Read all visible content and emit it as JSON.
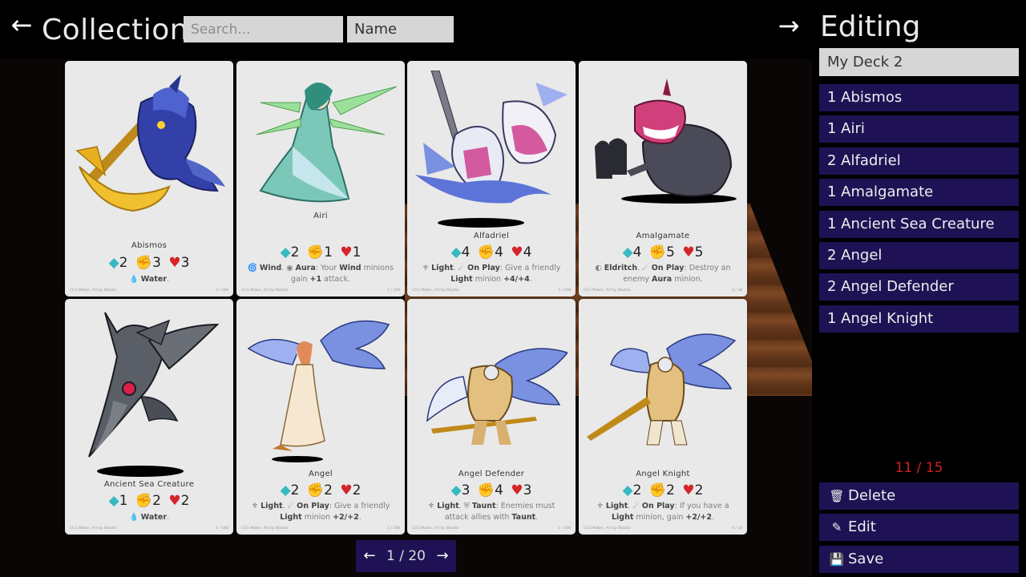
{
  "header": {
    "back_icon": "arrow-left-icon",
    "back_glyph": "←",
    "title": "Collection",
    "search_placeholder": "Search...",
    "sort_value": "Name",
    "forward_icon": "arrow-right-icon",
    "forward_glyph": "→"
  },
  "cards": [
    {
      "name": "Abismos",
      "mana": "2",
      "attack": "3",
      "health": "3",
      "text_html": "💧 <b>Water</b>.",
      "foot_left": "CCG Maker, Art by Blaatio",
      "foot_right": "1 / 168"
    },
    {
      "name": "Airi",
      "mana": "2",
      "attack": "1",
      "health": "1",
      "text_html": "🌀 <b>Wind</b>. ◉ <b>Aura</b>: Your <b>Wind</b> minions gain <b>+1</b> attack.",
      "foot_left": "CCG Maker, Art by Blaatio",
      "foot_right": "1 / 168"
    },
    {
      "name": "Alfadriel",
      "mana": "4",
      "attack": "4",
      "health": "4",
      "text_html": "⚜ <b>Light</b>. ☄ <b>On Play</b>: Give a friendly <b>Light</b> minion <b>+4/+4</b>.",
      "foot_left": "CCG Maker, Art by Blaatio",
      "foot_right": "1 / 168"
    },
    {
      "name": "Amalgamate",
      "mana": "4",
      "attack": "5",
      "health": "5",
      "text_html": "◐ <b>Eldritch</b>. ☄ <b>On Play</b>: Destroy an enemy <b>Aura</b> minion.",
      "foot_left": "CCG Maker, Art by Blaatio",
      "foot_right": "4 / 38"
    },
    {
      "name": "Ancient Sea Creature",
      "mana": "1",
      "attack": "2",
      "health": "2",
      "text_html": "💧 <b>Water</b>.",
      "foot_left": "CCG Maker, Art by Blaatio",
      "foot_right": "1 / 168"
    },
    {
      "name": "Angel",
      "mana": "2",
      "attack": "2",
      "health": "2",
      "text_html": "⚜ <b>Light</b>. ☄ <b>On Play</b>: Give a friendly <b>Light</b> minion <b>+2/+2</b>.",
      "foot_left": "CCG Maker, Art by Blaatio",
      "foot_right": "3 / 168"
    },
    {
      "name": "Angel Defender",
      "mana": "3",
      "attack": "4",
      "health": "3",
      "text_html": "⚜ <b>Light</b>. ⛨ <b>Taunt</b>: Enemies must attack allies with <b>Taunt</b>.",
      "foot_left": "CCG Maker, Art by Blaatio",
      "foot_right": "1 / 168"
    },
    {
      "name": "Angel Knight",
      "mana": "2",
      "attack": "2",
      "health": "2",
      "text_html": "⚜ <b>Light</b>. ☄ <b>On Play</b>: If you have a <b>Light</b> minion, gain <b>+2/+2</b>.",
      "foot_left": "CCG Maker, Art by Blaatio",
      "foot_right": "4 / 18"
    }
  ],
  "pagination": {
    "prev_glyph": "←",
    "label": "1 / 20",
    "next_glyph": "→"
  },
  "editing": {
    "title": "Editing",
    "deck_name": "My Deck 2",
    "items": [
      "1 Abismos",
      "1 Airi",
      "2 Alfadriel",
      "1 Amalgamate",
      "1 Ancient Sea Creature",
      "2 Angel",
      "2 Angel Defender",
      "1 Angel Knight"
    ],
    "count": "11 / 15",
    "delete_label": "Delete",
    "delete_icon": "trash-icon",
    "edit_label": "Edit",
    "edit_icon": "pencil-icon",
    "save_label": "Save",
    "save_icon": "floppy-disk-icon"
  },
  "colors": {
    "panel_bg": "#000000",
    "button_bg": "#1f1254",
    "card_bg": "#e9e9e9",
    "mana": "#37b9c0",
    "attack": "#e0a030",
    "health": "#d4252b",
    "count": "#d12020"
  }
}
